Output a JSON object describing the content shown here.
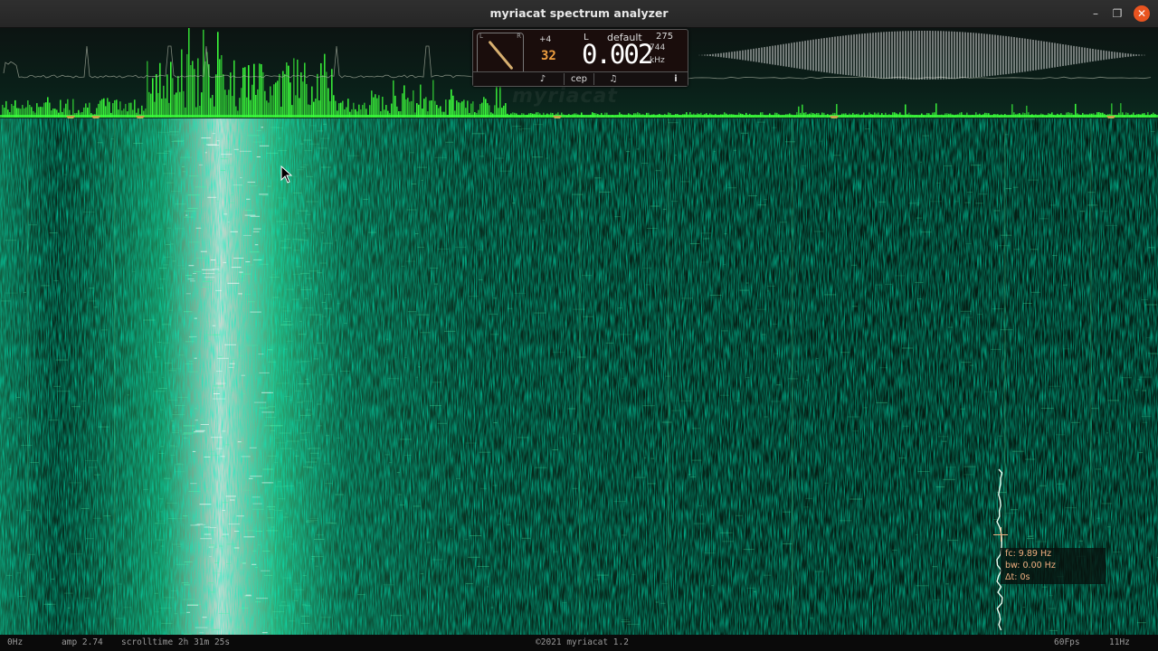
{
  "window": {
    "title": "myriacat spectrum analyzer",
    "min_label": "–",
    "max_label": "❐",
    "close_label": "✕"
  },
  "display": {
    "channel_offset": "+4",
    "channel": "L",
    "preset": "default",
    "value_275": "275",
    "bits": "32",
    "readout": "0.002",
    "sub_value": "744",
    "unit": "kHz",
    "knob_left": "L",
    "knob_right": "R",
    "buttons": {
      "tune": "♪",
      "cepstrum": "cep",
      "note": "♫",
      "info": "i"
    }
  },
  "watermark": "myriacat",
  "cursor_tooltip": {
    "fc": "fc: 9.89 Hz",
    "bw": "bw: 0.00 Hz",
    "dt": "Δt: 0s"
  },
  "status": {
    "min_freq": "0Hz",
    "amp": "amp 2.74",
    "scrolltime": "scrolltime 2h 31m 25s",
    "copyright": "©2021 myriacat 1.2",
    "fps": "60Fps",
    "max_freq": "11Hz"
  },
  "colors": {
    "spectrum": "#3cff3c",
    "waterfall_bright": "#ffffff",
    "waterfall_mid": "#2fd08a",
    "waterfall_bg": "#03140d",
    "marker": "#c8a84a",
    "accent_close": "#e95420"
  }
}
